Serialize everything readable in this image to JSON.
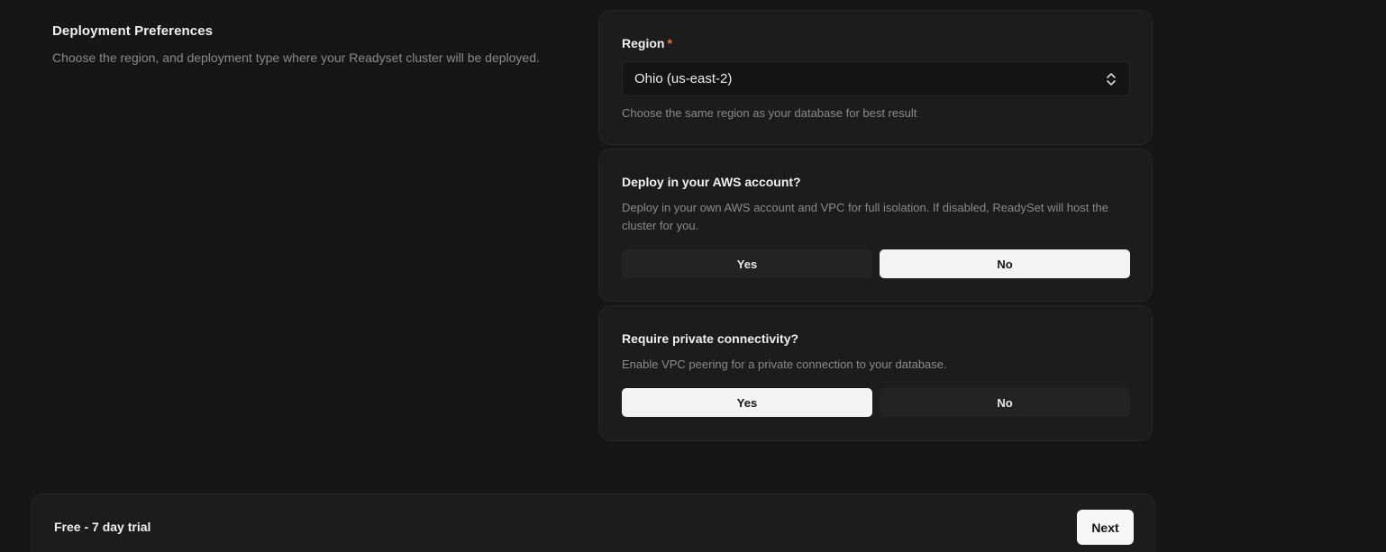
{
  "section": {
    "title": "Deployment Preferences",
    "description": "Choose the region, and deployment type where your Readyset cluster will be deployed."
  },
  "region": {
    "label": "Region",
    "required_mark": "*",
    "selected": "Ohio (us-east-2)",
    "helper": "Choose the same region as your database for best result",
    "icon": "chevron-up-down-icon"
  },
  "aws": {
    "label": "Deploy in your AWS account?",
    "description": "Deploy in your own AWS account and VPC for full isolation. If disabled, ReadySet will host the cluster for you.",
    "yes_label": "Yes",
    "no_label": "No",
    "selected": "No"
  },
  "private": {
    "label": "Require private connectivity?",
    "description": "Enable VPC peering for a private connection to your database.",
    "yes_label": "Yes",
    "no_label": "No",
    "selected": "Yes"
  },
  "footer": {
    "plan_label": "Free - 7 day trial",
    "next_label": "Next"
  },
  "colors": {
    "background": "#161616",
    "card": "#1c1c1c",
    "required": "#ff6a3d",
    "selected_option": "#f3f3f3"
  }
}
